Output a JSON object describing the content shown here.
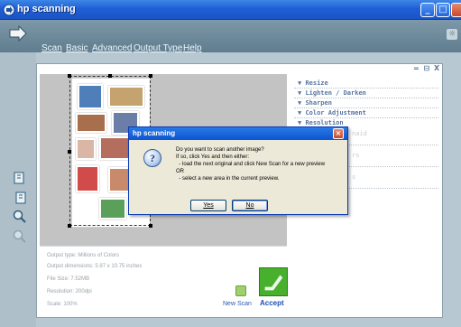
{
  "window": {
    "title": "hp scanning"
  },
  "menu": {
    "scan": "Scan",
    "basic": "Basic",
    "advanced": "Advanced",
    "output_type": "Output Type",
    "help": "Help"
  },
  "right_panel": {
    "controls": "= ⊟ X",
    "sections": [
      "Resize",
      "Lighten / Darken",
      "Sharpen",
      "Color Adjustment",
      "Resolution"
    ],
    "faded": [
      "naid",
      "rs",
      "s"
    ]
  },
  "info": {
    "output_type": "Output type: Millions of Colors",
    "output_dimensions": "Output dimensions: 5.97 x 10.75 inches",
    "file_size": "File Size: 7.52MB",
    "resolution": "Resolution: 200dpi",
    "scale": "Scale: 100%"
  },
  "actions": {
    "new_scan": "New Scan",
    "accept": "Accept"
  },
  "dialog": {
    "title": "hp scanning",
    "lines": [
      "Do you want to scan another image?",
      "If so, click Yes and then either:",
      "  - load the next original and click New Scan for a new preview",
      "OR",
      "  - select a new area in the current preview."
    ],
    "yes": "Yes",
    "no": "No"
  },
  "colors": {
    "titlebar": "#1f5fd6",
    "accept_green": "#48b02c",
    "section_header": "#5875a0"
  }
}
